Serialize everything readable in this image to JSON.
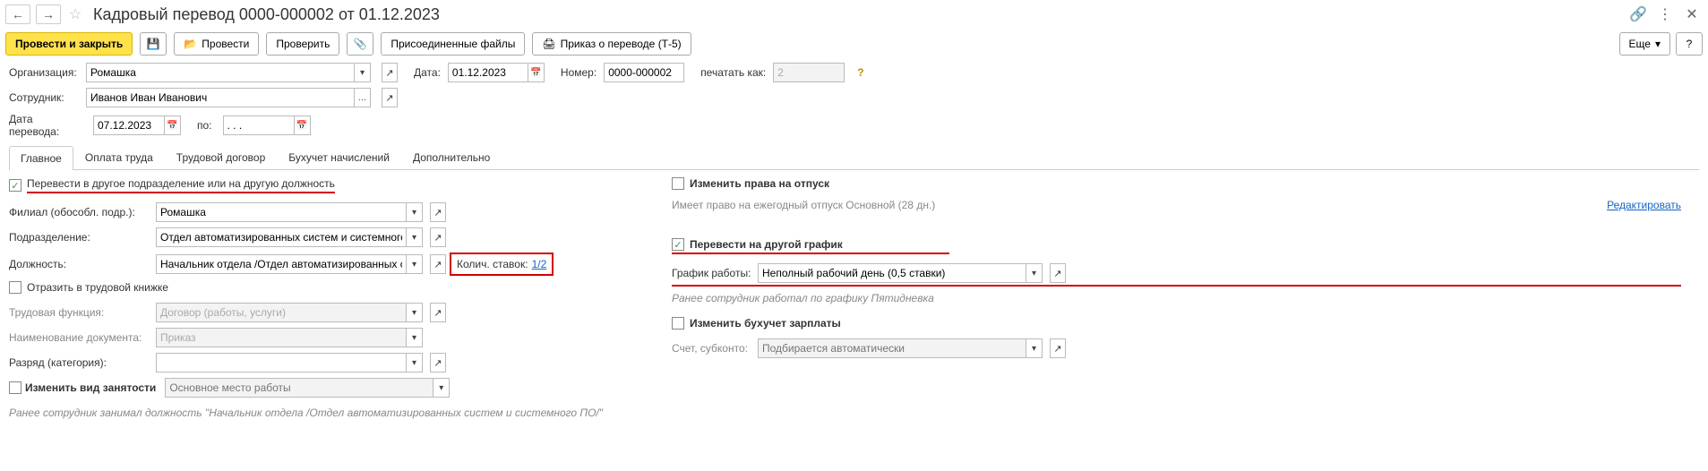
{
  "header": {
    "title": "Кадровый перевод 0000-000002 от 01.12.2023"
  },
  "toolbar": {
    "post_close": "Провести и закрыть",
    "post": "Провести",
    "check": "Проверить",
    "attached": "Присоединенные файлы",
    "order": "Приказ о переводе (Т-5)",
    "more": "Еще"
  },
  "fields": {
    "org_label": "Организация:",
    "org_value": "Ромашка",
    "date_label": "Дата:",
    "date_value": "01.12.2023",
    "number_label": "Номер:",
    "number_value": "0000-000002",
    "print_as_label": "печатать как:",
    "print_as_value": "2",
    "employee_label": "Сотрудник:",
    "employee_value": "Иванов Иван Иванович",
    "transfer_date_label": "Дата перевода:",
    "transfer_date_value": "07.12.2023",
    "to_label": "по:",
    "to_value": ". . ."
  },
  "tabs": {
    "main": "Главное",
    "pay": "Оплата труда",
    "contract": "Трудовой договор",
    "accrual": "Бухучет начислений",
    "extra": "Дополнительно"
  },
  "left": {
    "check_transfer": "Перевести в другое подразделение или на другую должность",
    "branch_label": "Филиал (обособл. подр.):",
    "branch_value": "Ромашка",
    "dept_label": "Подразделение:",
    "dept_value": "Отдел автоматизированных систем и системного ПО",
    "pos_label": "Должность:",
    "pos_value": "Начальник отдела /Отдел автоматизированных систем и сис",
    "rates_label": "Колич. ставок:",
    "rates_value": "1/2",
    "check_record": "Отразить в трудовой книжке",
    "func_label": "Трудовая функция:",
    "func_value": "Договор (работы, услуги)",
    "docname_label": "Наименование документа:",
    "docname_value": "Приказ",
    "rank_label": "Разряд (категория):",
    "check_emptype": "Изменить вид занятости",
    "emptype_ph": "Основное место работы",
    "footnote": "Ранее сотрудник занимал должность \"Начальник отдела /Отдел автоматизированных систем и системного ПО/\""
  },
  "right": {
    "check_vacation": "Изменить права на отпуск",
    "vac_text": "Имеет право на ежегодный отпуск Основной (28 дн.)",
    "edit": "Редактировать",
    "check_schedule": "Перевести на другой график",
    "schedule_label": "График работы:",
    "schedule_value": "Неполный рабочий день (0,5 ставки)",
    "prev_schedule": "Ранее сотрудник работал по графику Пятидневка",
    "check_acct": "Изменить бухучет зарплаты",
    "acct_label": "Счет, субконто:",
    "acct_ph": "Подбирается автоматически"
  }
}
